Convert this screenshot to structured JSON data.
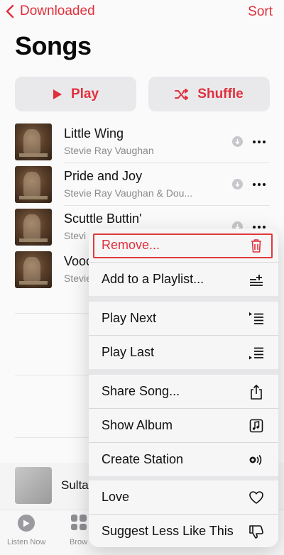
{
  "nav": {
    "back_label": "Downloaded",
    "sort_label": "Sort"
  },
  "page_title": "Songs",
  "actions": {
    "play_label": "Play",
    "shuffle_label": "Shuffle"
  },
  "songs": [
    {
      "title": "Little Wing",
      "artist": "Stevie Ray Vaughan"
    },
    {
      "title": "Pride and Joy",
      "artist": "Stevie Ray Vaughan & Dou..."
    },
    {
      "title": "Scuttle Buttin'",
      "artist": "Stevi"
    },
    {
      "title": "Vooc",
      "artist": "Stevie"
    }
  ],
  "mini_player": {
    "title": "Sulta"
  },
  "tabs": [
    {
      "label": "Listen Now",
      "icon": "play-circle-icon"
    },
    {
      "label": "Brow",
      "icon": "grid-icon"
    }
  ],
  "context_menu": {
    "groups": [
      [
        {
          "label": "Remove...",
          "icon": "trash-icon",
          "destructive": true
        },
        {
          "label": "Add to a Playlist...",
          "icon": "add-to-playlist-icon"
        }
      ],
      [
        {
          "label": "Play Next",
          "icon": "play-next-icon"
        },
        {
          "label": "Play Last",
          "icon": "play-last-icon"
        }
      ],
      [
        {
          "label": "Share Song...",
          "icon": "share-icon"
        },
        {
          "label": "Show Album",
          "icon": "music-note-icon"
        },
        {
          "label": "Create Station",
          "icon": "station-icon"
        }
      ],
      [
        {
          "label": "Love",
          "icon": "heart-icon"
        },
        {
          "label": "Suggest Less Like This",
          "icon": "thumbs-down-icon"
        }
      ]
    ]
  },
  "colors": {
    "accent": "#e0303c",
    "highlight_box": "#e03a3a"
  }
}
